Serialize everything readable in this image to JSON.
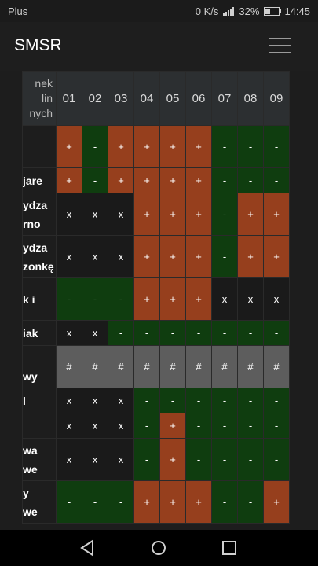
{
  "status": {
    "carrier": "Plus",
    "speed": "0 K/s",
    "battery": "32%",
    "time": "14:45",
    "battery_level": 0.32
  },
  "app": {
    "title": "SMSR"
  },
  "table": {
    "header_label": [
      "nek",
      "lin",
      "nych"
    ],
    "columns": [
      "01",
      "02",
      "03",
      "04",
      "05",
      "06",
      "07",
      "08",
      "09"
    ],
    "rows": [
      {
        "label": [
          ""
        ],
        "cells": [
          "+",
          "-",
          "+",
          "+",
          "+",
          "+",
          "-",
          "-",
          "-"
        ]
      },
      {
        "label": [
          "jare"
        ],
        "cells": [
          "+",
          "-",
          "+",
          "+",
          "+",
          "+",
          "-",
          "-",
          "-"
        ]
      },
      {
        "label": [
          "ydza",
          "rno"
        ],
        "cells": [
          "x",
          "x",
          "x",
          "+",
          "+",
          "+",
          "-",
          "+",
          "+"
        ]
      },
      {
        "label": [
          "ydza",
          "zonkę"
        ],
        "cells": [
          "x",
          "x",
          "x",
          "+",
          "+",
          "+",
          "-",
          "+",
          "+"
        ]
      },
      {
        "label": [
          "k i",
          ""
        ],
        "cells": [
          "-",
          "-",
          "-",
          "+",
          "+",
          "+",
          "x",
          "x",
          "x"
        ]
      },
      {
        "label": [
          "iak"
        ],
        "cells": [
          "x",
          "x",
          "-",
          "-",
          "-",
          "-",
          "-",
          "-",
          "-"
        ]
      },
      {
        "label": [
          "",
          "wy"
        ],
        "cells": [
          "#",
          "#",
          "#",
          "#",
          "#",
          "#",
          "#",
          "#",
          "#"
        ]
      },
      {
        "label": [
          "l"
        ],
        "cells": [
          "x",
          "x",
          "x",
          "-",
          "-",
          "-",
          "-",
          "-",
          "-"
        ]
      },
      {
        "label": [
          ""
        ],
        "cells": [
          "x",
          "x",
          "x",
          "-",
          "+",
          "-",
          "-",
          "-",
          "-"
        ]
      },
      {
        "label": [
          "wa",
          "we"
        ],
        "cells": [
          "x",
          "x",
          "x",
          "-",
          "+",
          "-",
          "-",
          "-",
          "-"
        ]
      },
      {
        "label": [
          "y",
          "we"
        ],
        "cells": [
          "-",
          "-",
          "-",
          "+",
          "+",
          "+",
          "-",
          "-",
          "+"
        ]
      }
    ]
  },
  "nav": {
    "back": "back-icon",
    "home": "home-icon",
    "recents": "recents-icon"
  }
}
